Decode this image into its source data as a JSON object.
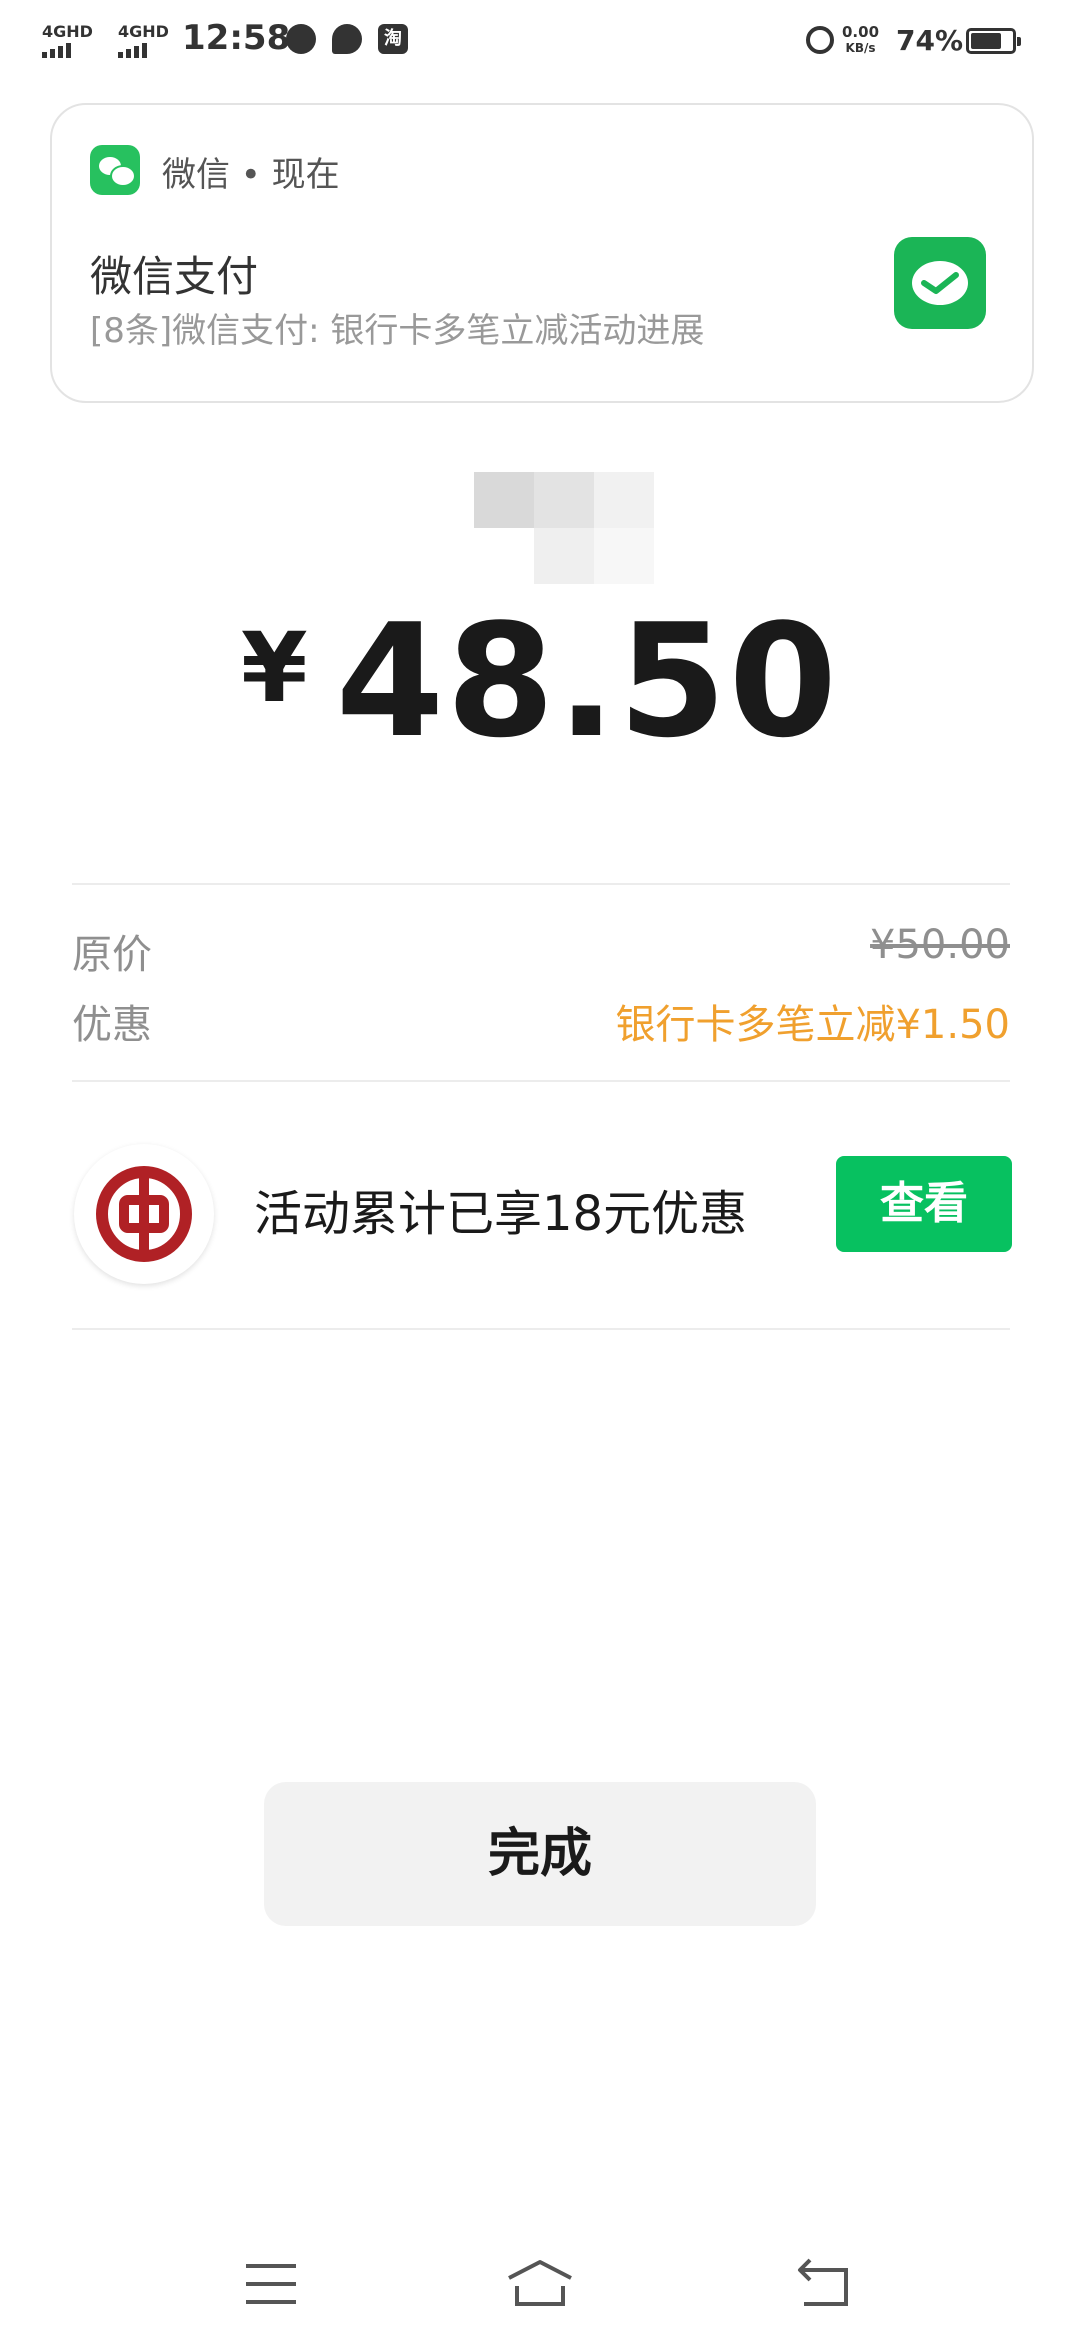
{
  "status_bar": {
    "signal1": "4GHD",
    "signal2": "4GHD",
    "time": "12:58",
    "notif_icons": [
      "wechat-icon",
      "chat-bubble-icon",
      "taobao-icon"
    ],
    "taobao_glyph": "淘",
    "alarm_icon": "alarm-icon",
    "net_speed_value": "0.00",
    "net_speed_unit": "KB/s",
    "battery_percent": "74%",
    "battery_level": 0.74
  },
  "notification": {
    "app_icon": "wechat-icon",
    "app_name_time": "微信 • 现在",
    "title": "微信支付",
    "body": "[8条]微信支付: 银行卡多笔立减活动进展",
    "right_icon": "wechat-pay-icon"
  },
  "payment": {
    "currency_symbol": "¥",
    "amount": "48.50"
  },
  "details": {
    "original_label": "原价",
    "original_value": "¥50.00",
    "discount_label": "优惠",
    "discount_value": "银行卡多笔立减¥1.50"
  },
  "promo": {
    "bank_icon": "bank-of-china-logo",
    "text": "活动累计已享18元优惠",
    "button": "查看"
  },
  "done_button": "完成",
  "nav_bar": {
    "menu_icon": "menu-icon",
    "home_icon": "home-icon",
    "back_icon": "back-icon"
  },
  "colors": {
    "wechat_green": "#07c160",
    "discount_orange": "#f0a02e",
    "bank_red": "#b02125"
  }
}
